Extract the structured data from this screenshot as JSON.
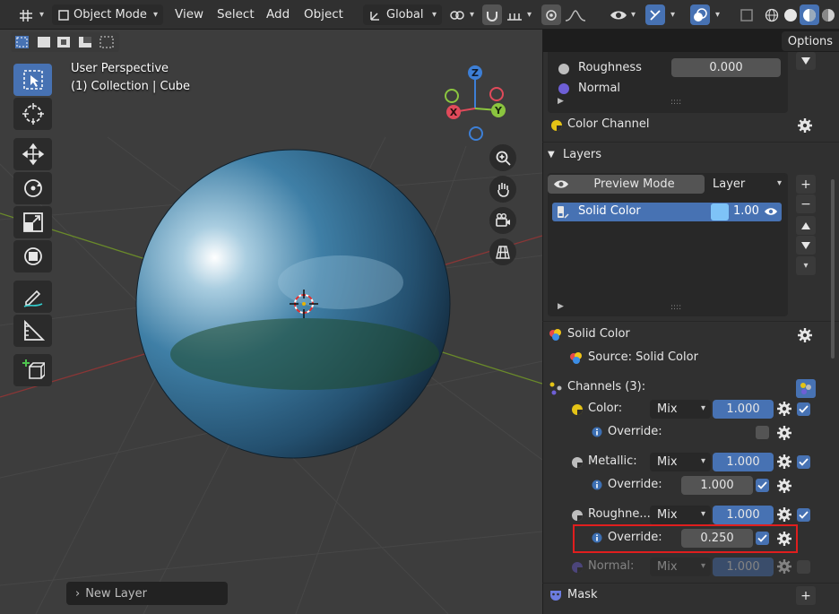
{
  "header": {
    "mode": "Object Mode",
    "menus": [
      "View",
      "Select",
      "Add",
      "Object"
    ],
    "orientation": "Global"
  },
  "viewport": {
    "title": "User Perspective",
    "collection": "(1) Collection | Cube",
    "gizmo_axes": {
      "z": "Z",
      "x": "X",
      "y": "Y"
    },
    "options_label": "Options",
    "new_layer_label": "New Layer"
  },
  "panel": {
    "top_rows": [
      {
        "label": "Roughness",
        "value": "0.000",
        "dot_color": "#bdbdbd"
      },
      {
        "label": "Normal",
        "dot_color": "#6e5fd6"
      }
    ],
    "color_channel_label": "Color Channel",
    "layers_header": "Layers",
    "preview_mode_label": "Preview Mode",
    "layer_dropdown": "Layer",
    "layer_item": {
      "name": "Solid Color",
      "value": "1.00",
      "swatch": "#7ec3f7"
    },
    "solid_color_header": "Solid Color",
    "source_label": "Source: Solid Color",
    "channels_header": "Channels (3):",
    "channels": [
      {
        "name": "Color:",
        "blend": "Mix",
        "value": "1.000",
        "override_label": "Override:",
        "override_value": "",
        "override_checked": false
      },
      {
        "name": "Metallic:",
        "blend": "Mix",
        "value": "1.000",
        "override_label": "Override:",
        "override_value": "1.000",
        "override_checked": true
      },
      {
        "name": "Roughne...",
        "blend": "Mix",
        "value": "1.000",
        "override_label": "Override:",
        "override_value": "0.250",
        "override_checked": true
      },
      {
        "name": "Normal:",
        "blend": "Mix",
        "value": "1.000"
      }
    ],
    "mask_header": "Mask"
  },
  "colors": {
    "accent": "#4772b3",
    "highlight_box": "#e01e1e"
  }
}
